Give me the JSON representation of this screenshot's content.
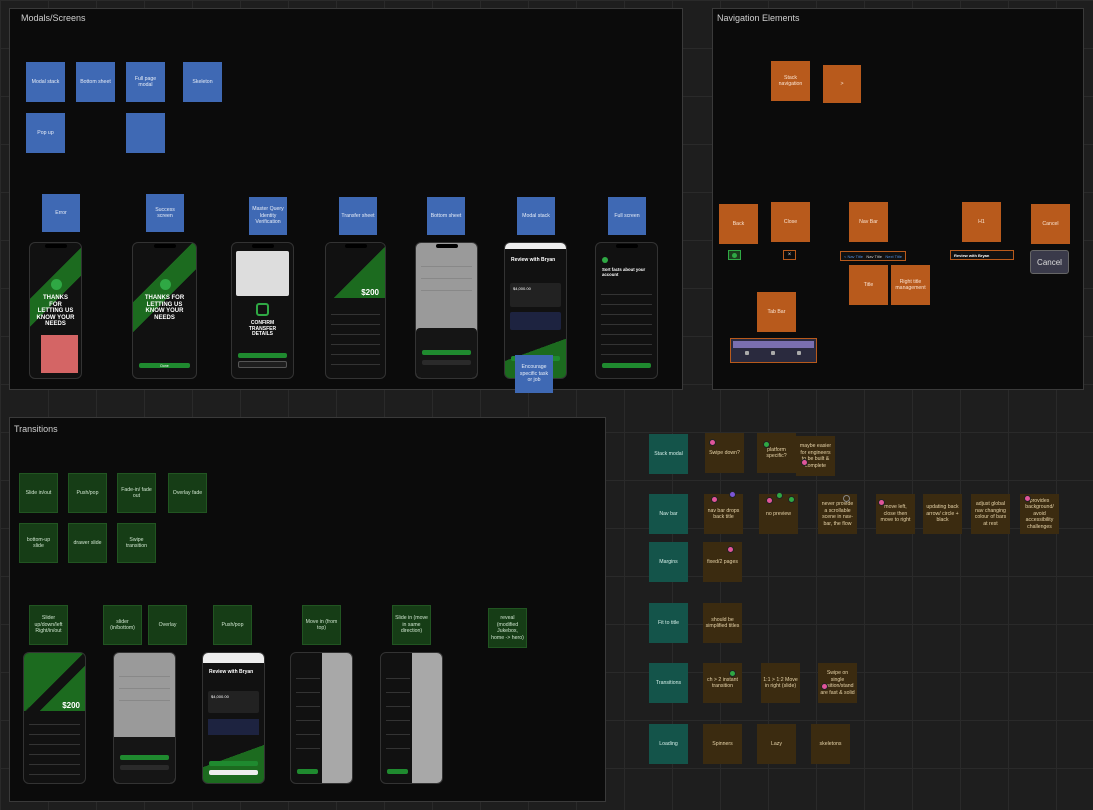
{
  "frames": {
    "modals": "Modals/Screens",
    "navigation": "Navigation Elements",
    "transitions": "Transitions"
  },
  "modals": {
    "top_row": [
      "Modal stack",
      "Bottom sheet",
      "Full page modal",
      "Skeleton",
      "Pop up",
      ""
    ],
    "labels": [
      "Error",
      "Success screen",
      "Master Query Identity Verification",
      "Transfer sheet",
      "Bottom sheet",
      "Modal stack",
      "Full screen"
    ],
    "extra_note": "Encourage specific task or job",
    "phones": {
      "thanks": "THANKS FOR LETTING US KNOW YOUR NEEDS",
      "confirm": "CONFIRM TRANSFER DETAILS",
      "review": "Review with Bryan",
      "balance": "$200",
      "amount": "$4,000.00",
      "done": "Done",
      "sort_note": "Sort facts about your account"
    }
  },
  "navigation": {
    "stack_nav": "Stack navigation",
    "arrow": ">",
    "back": "Back",
    "close": "Close",
    "nav_bar": "Nav Bar",
    "h1": "H1",
    "cancel": "Cancel",
    "cancel_button": "Cancel",
    "title": "Title",
    "right_title": "Right title management",
    "tab_bar": "Tab Bar",
    "navbar_back": "< Nav Title",
    "navbar_title": "Nav Title",
    "navbar_action": "Next Title",
    "review_title": "Review with Bryan"
  },
  "transitions": {
    "top_row": [
      "Slide in/out",
      "Push/pop",
      "Fade-in/ fade out",
      "Overlay fade",
      "bottom-up slide",
      "drawer slide",
      "Swipe transition"
    ],
    "labels": [
      "Slider up/down/left Right/in/out",
      "slider (in/bottom)",
      "Overlay",
      "Push/pop",
      "Move in (from top)",
      "Slide in (move in same direction)",
      "reveal (modified Jukebox, home -> hero)"
    ]
  },
  "stickies": {
    "row_labels": [
      "Stack modal",
      "Nav bar",
      "Margins",
      "Fit to title",
      "Transitions",
      "Loading"
    ],
    "stack_modal": [
      "Swipe down?",
      "platform specific?",
      "maybe easier for engineers to be built & complete"
    ],
    "nav_bar": [
      "nav bar drops back title",
      "no preview",
      "never provide a scrollable scene in nav-bar, the flow",
      "move left, close then move to right",
      "updating back arrow/ circle + black",
      "adjust global nav changing colour of bars at rest",
      "provides background/ avoid accessibility challenges"
    ],
    "margins": [
      "fixed/2 pages"
    ],
    "fit_to_title": [
      "should be simplified titles"
    ],
    "transitions": [
      "ch > 2 instant transition",
      "1:1 > 1:2 Move in right (slide)",
      "Swipe on single position/stand are fast & solid"
    ],
    "loading": [
      "Spinners",
      "Lazy",
      "skeletons"
    ]
  },
  "colors": {
    "blue": "#3f69b4",
    "orange": "#b85a1c",
    "green": "#163d16",
    "teal": "#14544a",
    "brown": "#3b2b10",
    "accent_green": "#1f8a2f",
    "dot_pink": "#e0559a",
    "dot_green": "#2fa844",
    "dot_purple": "#7b55d6"
  }
}
